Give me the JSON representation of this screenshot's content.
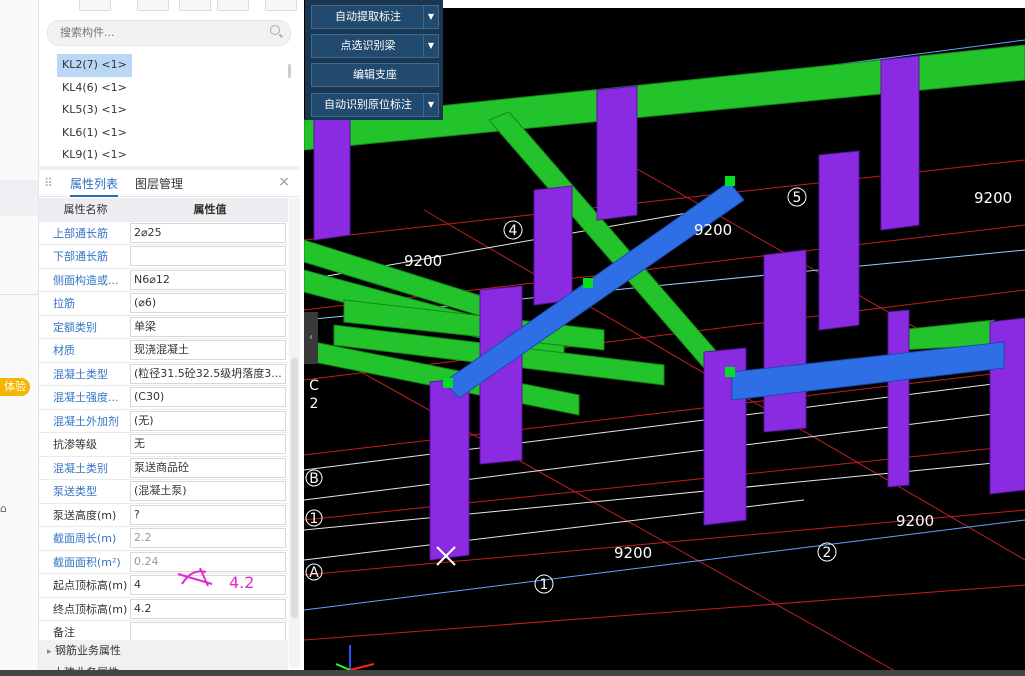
{
  "search": {
    "placeholder": "搜索构件..."
  },
  "component_list": [
    {
      "label": "KL2(7) <1>",
      "selected": true
    },
    {
      "label": "KL4(6) <1>",
      "selected": false
    },
    {
      "label": "KL5(3) <1>",
      "selected": false
    },
    {
      "label": "KL6(1) <1>",
      "selected": false
    },
    {
      "label": "KL9(1) <1>",
      "selected": false
    }
  ],
  "left_strip": {
    "badge": "体验"
  },
  "tabs": {
    "properties": "属性列表",
    "layers": "图层管理",
    "close": "×"
  },
  "table": {
    "header_name": "属性名称",
    "header_value": "属性值",
    "rows": [
      {
        "name": "上部通长筋",
        "value": "2⌀25",
        "blue": true
      },
      {
        "name": "下部通长筋",
        "value": "",
        "blue": true
      },
      {
        "name": "侧面构造或...",
        "value": "N6⌀12",
        "blue": true
      },
      {
        "name": "拉筋",
        "value": "(⌀6)",
        "blue": true
      },
      {
        "name": "定额类别",
        "value": "单梁",
        "blue": true
      },
      {
        "name": "材质",
        "value": "现浇混凝土",
        "blue": true
      },
      {
        "name": "混凝土类型",
        "value": "(粒径31.5砼32.5级坍落度3...",
        "blue": true
      },
      {
        "name": "混凝土强度...",
        "value": "(C30)",
        "blue": true
      },
      {
        "name": "混凝土外加剂",
        "value": "(无)",
        "blue": true
      },
      {
        "name": "抗渗等级",
        "value": "无",
        "blue": false
      },
      {
        "name": "混凝土类别",
        "value": "泵送商品砼",
        "blue": true
      },
      {
        "name": "泵送类型",
        "value": "(混凝土泵)",
        "blue": true
      },
      {
        "name": "泵送高度(m)",
        "value": "?",
        "blue": false
      },
      {
        "name": "截面周长(m)",
        "value": "2.2",
        "blue": true,
        "grey": true
      },
      {
        "name": "截面面积(m²)",
        "value": "0.24",
        "blue": true,
        "grey": true
      },
      {
        "name": "起点顶标高(m)",
        "value": "4",
        "blue": false
      },
      {
        "name": "终点顶标高(m)",
        "value": "4.2",
        "blue": false
      },
      {
        "name": "备注",
        "value": "",
        "blue": false
      }
    ]
  },
  "sections": {
    "rebar": "钢筋业务属性",
    "next": "土建业务属性"
  },
  "annotation": {
    "text": "4.2"
  },
  "toolbar": {
    "auto_extract": "自动提取标注",
    "pick_identify": "点选识别梁",
    "edit_support": "编辑支座",
    "auto_identify_inplace": "自动识别原位标注"
  },
  "viewport": {
    "dims": [
      "9200",
      "9200",
      "9200",
      "9200",
      "9200"
    ],
    "axis_numbers": [
      "1",
      "2",
      "4",
      "5"
    ],
    "axis_letters": [
      "A",
      "B",
      "C",
      "2",
      "1"
    ],
    "colors": {
      "column": "#8a2be2",
      "beam_green": "#22c32b",
      "beam_selected": "#2f6fe6",
      "handle": "#00e020"
    }
  }
}
